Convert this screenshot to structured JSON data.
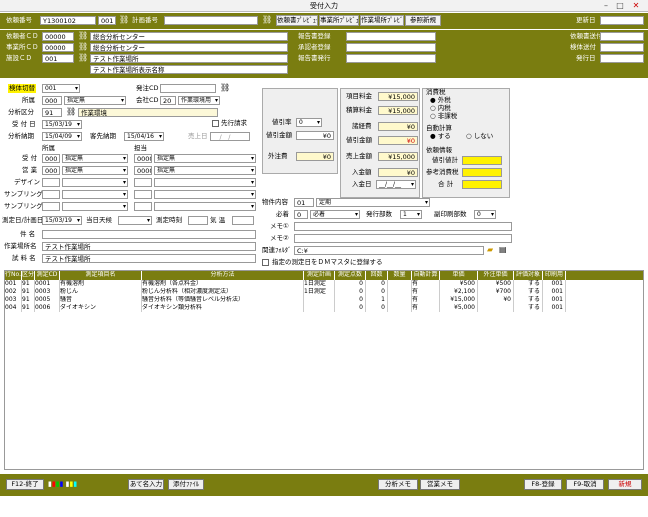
{
  "window": {
    "title": "受付入力"
  },
  "hdr": {
    "irai_label": "依頼番号",
    "irai_no": "Y1300102",
    "irai_sub": "001",
    "keikaku_label": "計画番号",
    "btn1": "依頼書ﾌﾟﾚﾋﾞｭｰ",
    "btn2": "事業所ﾌﾟﾚﾋﾞｭｰ",
    "btn3": "作業場所ﾌﾟﾚﾋﾞｭｰ",
    "btn4": "参照新規",
    "koushin_label": "更新日"
  },
  "info": {
    "irai_cd_label": "依頼者ＣＤ",
    "irai_cd": "00000",
    "irai_name": "総合分析センター",
    "jigyo_cd_label": "事業所ＣＤ",
    "jigyo_cd": "00000",
    "jigyo_name": "総合分析センター",
    "shisetsu_cd_label": "施設ＣＤ",
    "shisetsu_cd": "001",
    "shisetsu_name": "テスト作業場所",
    "shisetsu_disp": "テスト作業場所表示名称",
    "hokoku_touroku": "報告書登録",
    "shonin_touroku": "承認者登録",
    "hokoku_hakko": "報告書発行",
    "irai_sofu": "依頼書送付",
    "kekka_sofu": "検体送付",
    "hakko_bi": "発行日"
  },
  "form": {
    "kentai_label": "検体切替",
    "kentai_val": "001",
    "hacchu_label": "発注CD",
    "shozoku_label": "所属",
    "shozoku_val": "000",
    "shozoku_sel": "指定無",
    "kaisha_label": "会社CD",
    "kaisha_val": "20",
    "kaisha_name": "作業環境用",
    "bunseki_label": "分析区分",
    "bunseki_val": "91",
    "bunseki_name": "作業環境",
    "uketsuke_label": "受 付 日",
    "uketsuke_val": "15/03/19",
    "sakidori": "先行請求",
    "noki_label": "分析納期",
    "noki_val": "15/04/09",
    "kyaku_label": "客先納期",
    "kyaku_val": "15/04/16",
    "uriage_label": "売上日",
    "uriage_val": "__/__/__",
    "shozoku2": "所属",
    "tantou": "担当",
    "uke_label": "受 付",
    "uke_s": "000",
    "uke_s2": "指定無",
    "uke_t": "0000",
    "uke_t2": "指定無",
    "ei_label": "営 業",
    "ei_s": "000",
    "ei_s2": "指定無",
    "ei_t": "0000",
    "ei_t2": "指定無",
    "design": "デザイン",
    "sampling1": "サンプリング",
    "sampling2": "サンプリング",
    "sokutei_label": "測定日/計画日",
    "sokutei_val": "15/03/19",
    "touji": "当日天候",
    "sokutei_time": "測定時刻",
    "kion": "気 温",
    "ken": "件 名",
    "sagyo_label": "作業場所名",
    "sagyo_val": "テスト作業場所",
    "shiryo_label": "試 料 名",
    "shiryo_val": "テスト作業場所"
  },
  "mid": {
    "nebiki_label": "値引率",
    "nebiki_val": "0",
    "nebiki_kin_label": "値引金額",
    "nebiki_kin_val": "¥0",
    "gaichu_label": "外注費",
    "gaichu_val": "¥0",
    "koumoku_label": "項目料金",
    "koumoku_val": "¥15,000",
    "seki_label": "積算料金",
    "seki_val": "¥15,000",
    "kaku_label": "諸経費",
    "kaku_val": "¥0",
    "nebiki2_label": "値引金額",
    "nebiki2_val": "¥0",
    "uriage_label": "売上金額",
    "uriage_val": "¥15,000",
    "nyukin_label": "入金額",
    "nyukin_val": "¥0",
    "nyukin_bi": "入金日",
    "nyukin_bi_val": "__/__/__"
  },
  "tax": {
    "title": "消費税",
    "opt1": "外税",
    "opt2": "内税",
    "opt3": "非課税",
    "jido_title": "自動計算",
    "jido1": "する",
    "jido2": "しない",
    "irai_title": "依頼情報",
    "nebiki_total": "値引値計",
    "sanko": "参考消費税",
    "goukei": "合 計"
  },
  "right": {
    "bukken_label": "物件内容",
    "bukken_val": "01",
    "bukken_name": "定期",
    "hitsuyo_label": "必着",
    "hitsuyo_val": "0",
    "hitsuyo_name": "必着",
    "hakko_busu": "発行部数",
    "hakko_val": "1",
    "fuku_busu": "副印刷部数",
    "fuku_val": "0",
    "memo1": "メモ①",
    "memo2": "メモ②",
    "kanren_label": "関連ﾌｫﾙﾀﾞ",
    "kanren_val": "C:¥",
    "check_label": "指定の測定日をＤＭマスタに登録する"
  },
  "table": {
    "headers": [
      "行No.",
      "区分",
      "測定CD",
      "測定項目名",
      "分析方法",
      "測定計画",
      "測定点数",
      "回数",
      "数量",
      "自動計算",
      "単価",
      "外注単価",
      "評価対象",
      "印刷用"
    ],
    "rows": [
      [
        "001",
        "91",
        "0001",
        "有機溶剤",
        "有機溶剤（各点料金）",
        "1日測定",
        "0",
        "0",
        "有",
        "¥500",
        "¥500",
        "する",
        "001"
      ],
      [
        "002",
        "91",
        "0003",
        "粉じん",
        "粉じん分析料（相対濃度測定法）",
        "1日測定",
        "0",
        "0",
        "有",
        "¥2,100",
        "¥700",
        "する",
        "001"
      ],
      [
        "003",
        "91",
        "0005",
        "騒音",
        "騒音分析料（等価騒音レベル分析法）",
        "",
        "0",
        "1",
        "有",
        "¥15,000",
        "¥0",
        "する",
        "001"
      ],
      [
        "004",
        "91",
        "0006",
        "ダイオキシン",
        "ダイオキシン類分析料",
        "",
        "0",
        "0",
        "有",
        "¥5,000",
        "",
        "する",
        "001"
      ]
    ]
  },
  "footer": {
    "f12": "F12-終了",
    "atena": "あて名入力",
    "tenpu": "添付ﾌｧｲﾙ",
    "bunseki_memo": "分析メモ",
    "eigyo_memo": "営業メモ",
    "f8": "F8-登録",
    "f9": "F9-取消",
    "shinki": "新規"
  }
}
